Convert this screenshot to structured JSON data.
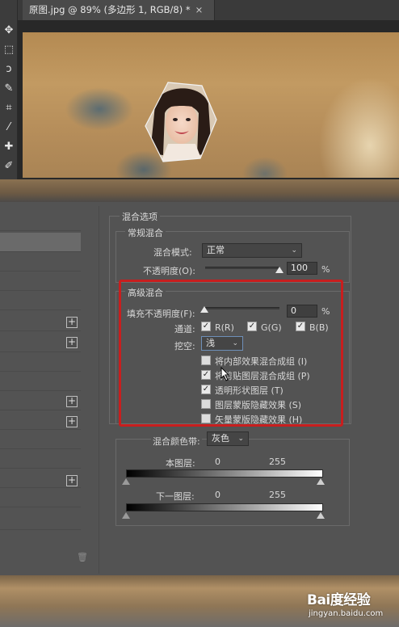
{
  "document": {
    "tab_title": "原图.jpg @ 89% (多边形 1, RGB/8) *",
    "close_glyph": "×"
  },
  "tools": [
    "move-icon",
    "marquee-icon",
    "lasso-icon",
    "quick-select-icon",
    "crop-icon",
    "eyedropper-icon",
    "healing-icon",
    "brush-icon"
  ],
  "blending_options": {
    "title": "混合选项",
    "general": {
      "legend": "常规混合",
      "blend_mode_label": "混合模式:",
      "blend_mode_value": "正常",
      "opacity_label": "不透明度(O):",
      "opacity_value": "100",
      "opacity_unit": "%"
    },
    "advanced": {
      "legend": "高级混合",
      "fill_opacity_label": "填充不透明度(F):",
      "fill_opacity_value": "0",
      "fill_opacity_unit": "%",
      "channels_label": "通道:",
      "channel_r": "R(R)",
      "channel_g": "G(G)",
      "channel_b": "B(B)",
      "knockout_label": "挖空:",
      "knockout_value": "浅",
      "options": [
        {
          "label": "将内部效果混合成组 (I)",
          "checked": false
        },
        {
          "label": "将剪贴图层混合成组 (P)",
          "checked": true
        },
        {
          "label": "透明形状图层 (T)",
          "checked": true
        },
        {
          "label": "图层蒙版隐藏效果 (S)",
          "checked": false
        },
        {
          "label": "矢量蒙版隐藏效果 (H)",
          "checked": false
        }
      ]
    },
    "blend_if": {
      "label": "混合颜色带:",
      "value": "灰色",
      "this_layer_label": "本图层:",
      "this_layer_min": "0",
      "this_layer_max": "255",
      "under_layer_label": "下一图层:",
      "under_layer_min": "0",
      "under_layer_max": "255"
    }
  },
  "watermark": {
    "logo": "Bai度经验",
    "sub": "jingyan.baidu.com"
  }
}
